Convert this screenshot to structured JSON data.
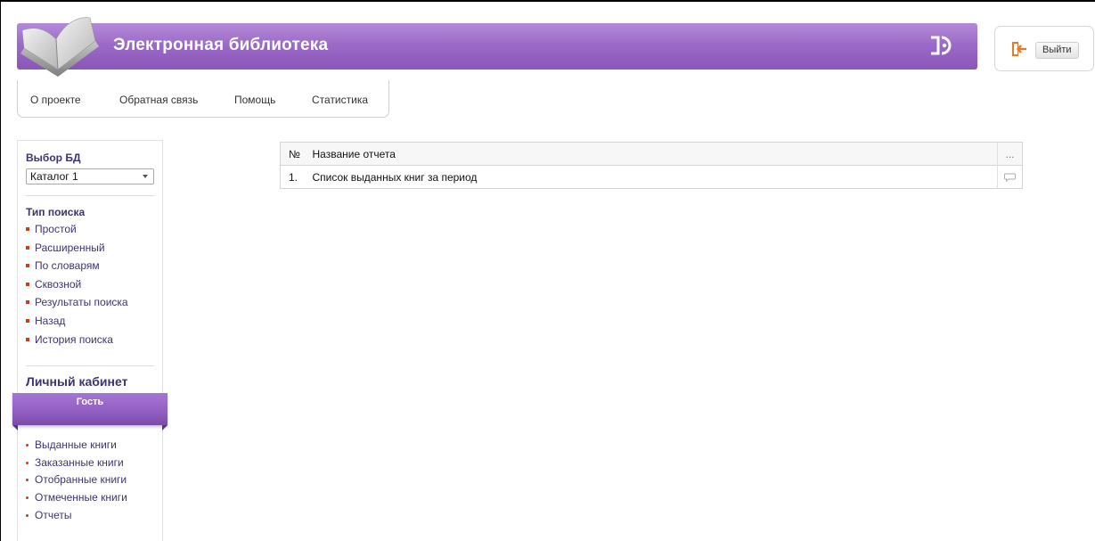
{
  "header": {
    "title": "Электронная библиотека",
    "logout_label": "Выйти"
  },
  "topnav": {
    "items": [
      {
        "label": "О проекте"
      },
      {
        "label": "Обратная связь"
      },
      {
        "label": "Помощь"
      },
      {
        "label": "Статистика"
      }
    ]
  },
  "sidebar": {
    "db_heading": "Выбор БД",
    "db_selected": "Каталог 1",
    "search_heading": "Тип поиска",
    "search_types": [
      {
        "label": "Простой"
      },
      {
        "label": "Расширенный"
      },
      {
        "label": "По словарям"
      },
      {
        "label": "Сквозной"
      },
      {
        "label": "Результаты поиска"
      },
      {
        "label": "Назад"
      },
      {
        "label": "История поиска"
      }
    ],
    "cabinet_heading": "Личный кабинет",
    "user_name": "Гость",
    "cabinet_items": [
      {
        "label": "Выданные книги"
      },
      {
        "label": "Заказанные книги"
      },
      {
        "label": "Отобранные книги"
      },
      {
        "label": "Отмеченные книги"
      },
      {
        "label": "Отчеты"
      }
    ]
  },
  "reports": {
    "columns": {
      "num": "№",
      "name": "Название отчета",
      "more": "..."
    },
    "rows": [
      {
        "num": "1.",
        "name": "Список выданных книг за период"
      }
    ]
  },
  "colors": {
    "header_purple": "#9a68c6",
    "link_text": "#3d3470",
    "bullet": "#cc3b1c"
  },
  "icons": [
    "book-logo-icon",
    "brand-mark-icon",
    "logout-icon",
    "dropdown-arrow-icon",
    "comment-icon"
  ]
}
